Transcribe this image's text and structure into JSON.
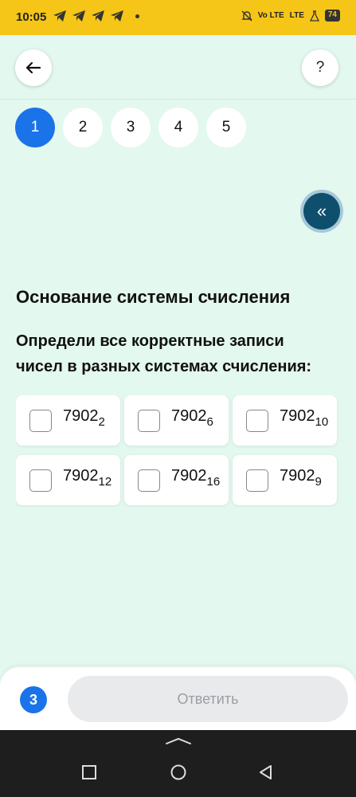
{
  "status_bar": {
    "time": "10:05",
    "network_label": "Vo LTE",
    "signal_label": "LTE",
    "battery": "74",
    "icons": [
      "telegram-icon",
      "telegram-icon",
      "telegram-icon",
      "telegram-icon",
      "dot-icon",
      "mute-icon",
      "signal-icon",
      "flask-icon",
      "battery-icon"
    ]
  },
  "header": {
    "back_icon": "arrow-left-icon",
    "help_label": "?"
  },
  "steps": [
    {
      "label": "1",
      "active": true
    },
    {
      "label": "2",
      "active": false
    },
    {
      "label": "3",
      "active": false
    },
    {
      "label": "4",
      "active": false
    },
    {
      "label": "5",
      "active": false
    }
  ],
  "collapse_icon_label": "«",
  "task": {
    "title": "Основание системы счисления",
    "question": "Определи все корректные записи чисел в разных системах счисления:"
  },
  "options": [
    {
      "number": "7902",
      "base": "2",
      "checked": false
    },
    {
      "number": "7902",
      "base": "6",
      "checked": false
    },
    {
      "number": "7902",
      "base": "10",
      "checked": false
    },
    {
      "number": "7902",
      "base": "12",
      "checked": false
    },
    {
      "number": "7902",
      "base": "16",
      "checked": false
    },
    {
      "number": "7902",
      "base": "9",
      "checked": false
    }
  ],
  "footer": {
    "attempts": "3",
    "answer_label": "Ответить"
  },
  "colors": {
    "status_bar": "#f5c518",
    "background": "#e3f8ee",
    "accent": "#1a73e8",
    "collapse_button": "#0e4f6e",
    "disabled_button": "#e9eaec"
  }
}
